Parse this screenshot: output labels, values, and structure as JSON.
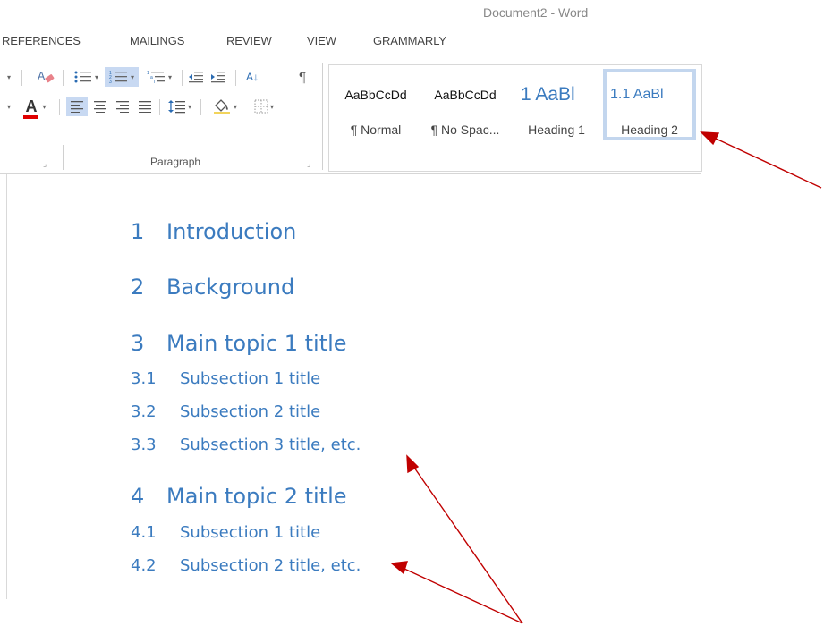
{
  "window": {
    "title": "Document2 - Word"
  },
  "tabs": [
    "REFERENCES",
    "MAILINGS",
    "REVIEW",
    "VIEW",
    "GRAMMARLY"
  ],
  "ribbon": {
    "paragraph_group_label": "Paragraph",
    "font_color_letter": "A",
    "highlight_letter": "A",
    "sort_glyph": "A↓",
    "pilcrow": "¶",
    "styles": [
      {
        "preview": "AaBbCcDd",
        "name": "¶ Normal"
      },
      {
        "preview": "AaBbCcDd",
        "name": "¶ No Spac..."
      },
      {
        "preview": "1  AaBl",
        "name": "Heading 1"
      },
      {
        "preview": "1.1  AaBl",
        "name": "Heading 2"
      }
    ]
  },
  "document": {
    "headings": [
      {
        "num": "1",
        "text": "Introduction"
      },
      {
        "num": "2",
        "text": "Background"
      },
      {
        "num": "3",
        "text": "Main topic 1 title"
      },
      {
        "num": "3.1",
        "text": "Subsection 1 title"
      },
      {
        "num": "3.2",
        "text": "Subsection 2 title"
      },
      {
        "num": "3.3",
        "text": "Subsection 3 title, etc."
      },
      {
        "num": "4",
        "text": "Main topic 2 title"
      },
      {
        "num": "4.1",
        "text": "Subsection 1 title"
      },
      {
        "num": "4.2",
        "text": "Subsection 2 title, etc."
      }
    ]
  },
  "colors": {
    "heading_blue": "#3b7bbf",
    "annotation_arrow": "#c00000",
    "font_color_underline": "#e00000",
    "selected_style_border": "#c3d6ee"
  }
}
